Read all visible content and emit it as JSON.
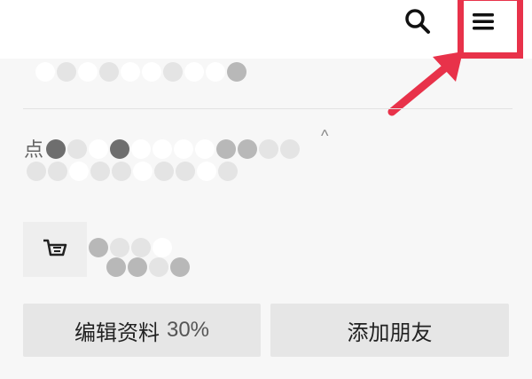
{
  "header": {
    "search_icon": "search-icon",
    "menu_icon": "hamburger-menu-icon",
    "highlight_color": "#e8324a"
  },
  "profile": {
    "note_glyph": "点",
    "caret_glyph": "^"
  },
  "actions": {
    "edit_profile_label": "编辑资料",
    "edit_profile_progress": "30%",
    "add_friend_label": "添加朋友"
  }
}
